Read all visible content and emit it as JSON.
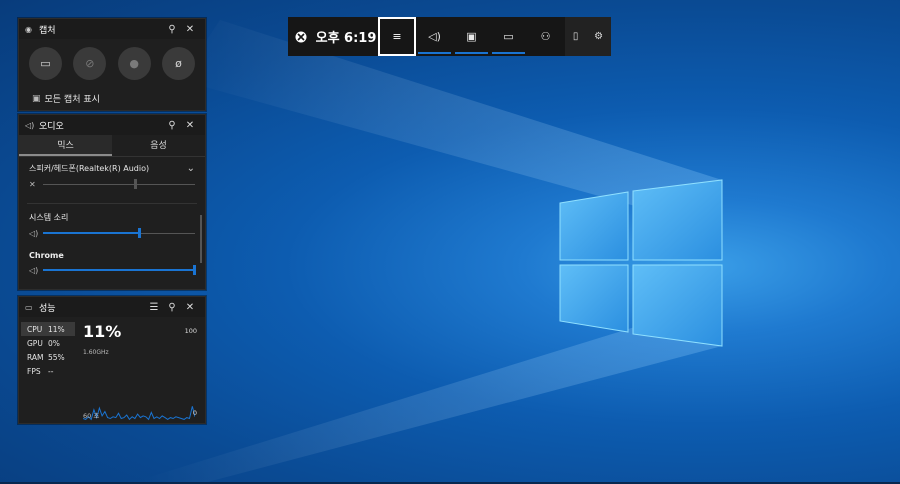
{
  "capture": {
    "title": "캡처",
    "show_all": "모든 캡처 표시"
  },
  "audio": {
    "title": "오디오",
    "tabs": [
      "믹스",
      "음성"
    ],
    "device": "스피커/헤드폰(Realtek(R) Audio)",
    "device_level": 0.61,
    "system_sound_label": "시스템 소리",
    "system_level": 0.64,
    "chrome_label": "Chrome",
    "chrome_level": 1.0
  },
  "performance": {
    "title": "성능",
    "stats": [
      {
        "key": "CPU",
        "value": "11%"
      },
      {
        "key": "GPU",
        "value": "0%"
      },
      {
        "key": "RAM",
        "value": "55%"
      },
      {
        "key": "FPS",
        "value": "--"
      }
    ],
    "big_value": "11%",
    "frequency": "1.60GHz",
    "max": "100",
    "min": "0",
    "span": "60 초",
    "cpu_history": [
      4,
      3,
      6,
      3,
      14,
      5,
      16,
      7,
      12,
      5,
      4,
      6,
      5,
      10,
      4,
      5,
      8,
      3,
      6,
      4,
      9,
      5,
      7,
      6,
      3,
      11,
      4,
      6,
      4,
      7,
      5,
      3,
      5,
      4,
      6,
      5,
      4,
      3,
      5,
      4,
      18,
      6
    ]
  },
  "gamebar": {
    "time": "오후 6:19"
  },
  "colors": {
    "accent": "#1a74d2",
    "panel": "#1f1f1f"
  }
}
